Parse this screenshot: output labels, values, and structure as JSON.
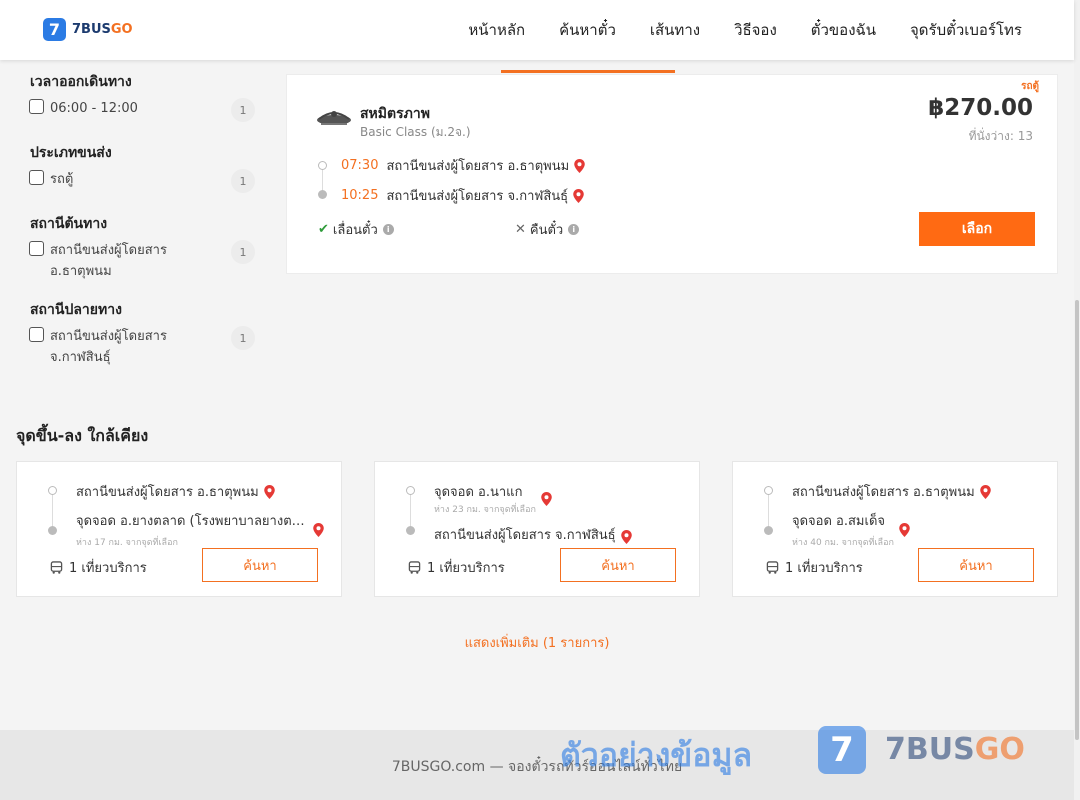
{
  "header": {
    "logo_icon": "7",
    "brand_part1": "7BUS",
    "brand_part2": "GO",
    "nav": [
      "หน้าหลัก",
      "ค้นหาตั๋ว",
      "เส้นทาง",
      "วิธีจอง",
      "ตั๋วของฉัน",
      "จุดรับตั๋วเบอร์โทร"
    ]
  },
  "filters": {
    "departure_time": {
      "title": "เวลาออกเดินทาง",
      "options": [
        {
          "label": "06:00 - 12:00",
          "count": "1"
        }
      ]
    },
    "transport_type": {
      "title": "ประเภทขนส่ง",
      "options": [
        {
          "label": "รถตู้",
          "count": "1"
        }
      ]
    },
    "origin_station": {
      "title": "สถานีต้นทาง",
      "options": [
        {
          "label": "สถานีขนส่งผู้โดยสาร อ.ธาตุพนม",
          "count": "1"
        }
      ]
    },
    "destination_station": {
      "title": "สถานีปลายทาง",
      "options": [
        {
          "label": "สถานีขนส่งผู้โดยสาร จ.กาฬสินธุ์",
          "count": "1"
        }
      ]
    }
  },
  "result": {
    "operator": "สหมิตรภาพ",
    "class": "Basic Class (ม.2จ.)",
    "vehicle_type": "รถตู้",
    "price": "฿270.00",
    "seats": "ที่นั่งว่าง: 13",
    "departure": {
      "time": "07:30",
      "station": "สถานีขนส่งผู้โดยสาร อ.ธาตุพนม"
    },
    "arrival": {
      "time": "10:25",
      "station": "สถานีขนส่งผู้โดยสาร จ.กาฬสินธุ์"
    },
    "reschedule": "เลื่อนตั๋ว",
    "refund": "คืนตั๋ว",
    "select_label": "เลือก"
  },
  "nearby": {
    "title": "จุดขึ้น-ลง ใกล้เคียง",
    "cards": [
      {
        "from": "สถานีขนส่งผู้โดยสาร อ.ธาตุพนม",
        "from_dist": "",
        "to": "จุดจอด อ.ยางตลาด (โรงพยาบาลยางตลาด)",
        "to_dist": "ห่าง 17 กม. จากจุดที่เลือก",
        "trips": "1 เที่ยวบริการ",
        "button": "ค้นหา"
      },
      {
        "from": "จุดจอด อ.นาแก",
        "from_dist": "ห่าง 23 กม. จากจุดที่เลือก",
        "to": "สถานีขนส่งผู้โดยสาร จ.กาฬสินธุ์",
        "to_dist": "",
        "trips": "1 เที่ยวบริการ",
        "button": "ค้นหา"
      },
      {
        "from": "สถานีขนส่งผู้โดยสาร อ.ธาตุพนม",
        "from_dist": "",
        "to": "จุดจอด อ.สมเด็จ",
        "to_dist": "ห่าง 40 กม. จากจุดที่เลือก",
        "trips": "1 เที่ยวบริการ",
        "button": "ค้นหา"
      }
    ],
    "more": "แสดงเพิ่มเติม (1 รายการ)"
  },
  "footer": {
    "text": "7BUSGO.com — จองตั๋วรถทัวร์ออนไลน์ทั่วไทย"
  },
  "watermark": {
    "text": "ตัวอย่างข้อมูล",
    "logo_icon": "7",
    "brand_part1": "7BUS",
    "brand_part2": "GO"
  },
  "colors": {
    "accent": "#f37021",
    "button": "#ff6a13",
    "brand_blue": "#2b7be4",
    "pin_red": "#e53935",
    "check_green": "#2e9b3a"
  },
  "icons": [
    "checkbox-icon",
    "pin-icon",
    "check-icon",
    "cross-icon",
    "info-icon",
    "bus-icon",
    "operator-logo-icon"
  ]
}
